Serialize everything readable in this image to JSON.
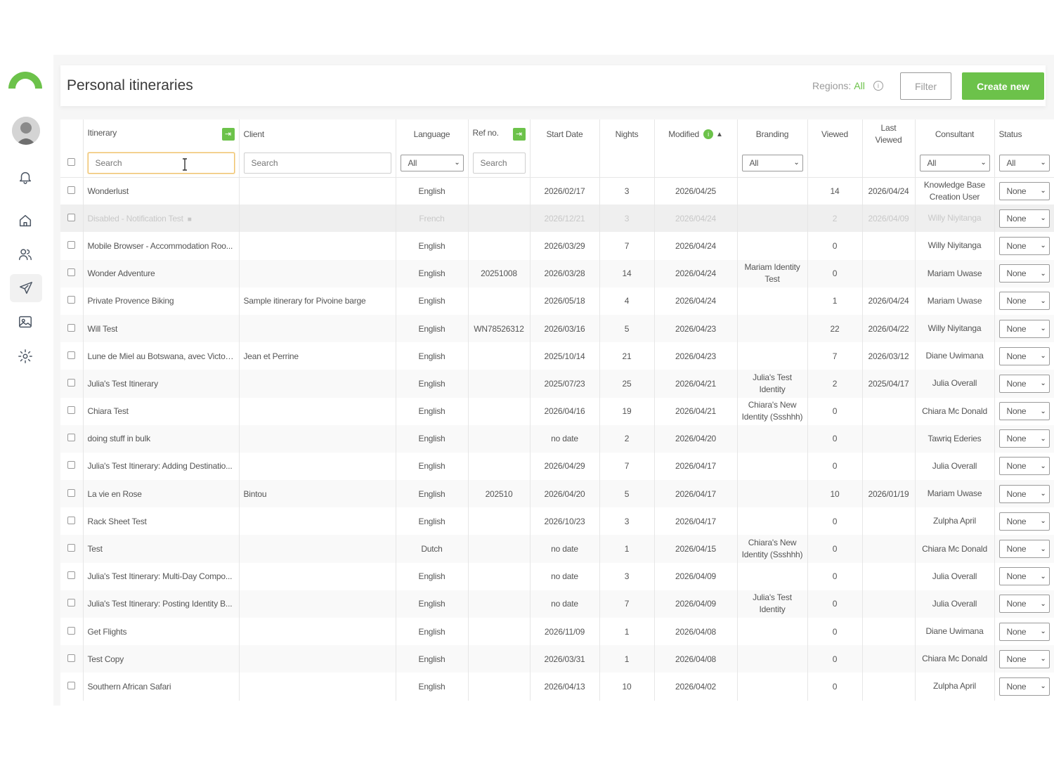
{
  "header": {
    "title": "Personal itineraries",
    "regions_label": "Regions:",
    "regions_value": "All",
    "filter_label": "Filter",
    "create_label": "Create new"
  },
  "sidebar": {
    "items": [
      {
        "name": "bell-icon"
      },
      {
        "name": "home-icon"
      },
      {
        "name": "users-icon"
      },
      {
        "name": "send-icon"
      },
      {
        "name": "image-icon"
      },
      {
        "name": "gear-icon"
      }
    ]
  },
  "table": {
    "columns": {
      "itinerary": "Itinerary",
      "client": "Client",
      "language": "Language",
      "ref": "Ref no.",
      "start": "Start Date",
      "nights": "Nights",
      "modified": "Modified",
      "branding": "Branding",
      "viewed": "Viewed",
      "last_viewed_1": "Last",
      "last_viewed_2": "Viewed",
      "consultant": "Consultant",
      "status": "Status"
    },
    "filters": {
      "itinerary_placeholder": "Search",
      "client_placeholder": "Search",
      "language_value": "All",
      "ref_placeholder": "Search",
      "branding_value": "All",
      "consultant_value": "All",
      "status_value": "All"
    },
    "rows": [
      {
        "itinerary": "Wonderlust",
        "client": "",
        "language": "English",
        "ref": "",
        "start": "2026/02/17",
        "nights": "3",
        "modified": "2026/04/25",
        "branding": "",
        "viewed": "14",
        "last_viewed": "2026/04/24",
        "consultant": "Knowledge Base Creation User",
        "status": "None"
      },
      {
        "itinerary": "Disabled - Notification Test",
        "client": "",
        "language": "French",
        "ref": "",
        "start": "2026/12/21",
        "nights": "3",
        "modified": "2026/04/24",
        "branding": "",
        "viewed": "2",
        "last_viewed": "2026/04/09",
        "consultant": "Willy Niyitanga",
        "status": "None",
        "disabled": true
      },
      {
        "itinerary": "Mobile Browser - Accommodation Roo...",
        "client": "",
        "language": "English",
        "ref": "",
        "start": "2026/03/29",
        "nights": "7",
        "modified": "2026/04/24",
        "branding": "",
        "viewed": "0",
        "last_viewed": "",
        "consultant": "Willy Niyitanga",
        "status": "None"
      },
      {
        "itinerary": "Wonder Adventure",
        "client": "",
        "language": "English",
        "ref": "20251008",
        "start": "2026/03/28",
        "nights": "14",
        "modified": "2026/04/24",
        "branding": "Mariam Identity Test",
        "viewed": "0",
        "last_viewed": "",
        "consultant": "Mariam Uwase",
        "status": "None"
      },
      {
        "itinerary": "Private Provence Biking",
        "client": "Sample itinerary for Pivoine barge",
        "language": "English",
        "ref": "",
        "start": "2026/05/18",
        "nights": "4",
        "modified": "2026/04/24",
        "branding": "",
        "viewed": "1",
        "last_viewed": "2026/04/24",
        "consultant": "Mariam Uwase",
        "status": "None"
      },
      {
        "itinerary": "Will Test",
        "client": "",
        "language": "English",
        "ref": "WN78526312",
        "start": "2026/03/16",
        "nights": "5",
        "modified": "2026/04/23",
        "branding": "",
        "viewed": "22",
        "last_viewed": "2026/04/22",
        "consultant": "Willy Niyitanga",
        "status": "None"
      },
      {
        "itinerary": "Lune de Miel au Botswana, avec Victori...",
        "client": "Jean et Perrine",
        "language": "English",
        "ref": "",
        "start": "2025/10/14",
        "nights": "21",
        "modified": "2026/04/23",
        "branding": "",
        "viewed": "7",
        "last_viewed": "2026/03/12",
        "consultant": "Diane Uwimana",
        "status": "None"
      },
      {
        "itinerary": "Julia's Test Itinerary",
        "client": "",
        "language": "English",
        "ref": "",
        "start": "2025/07/23",
        "nights": "25",
        "modified": "2026/04/21",
        "branding": "Julia's Test Identity",
        "viewed": "2",
        "last_viewed": "2025/04/17",
        "consultant": "Julia Overall",
        "status": "None"
      },
      {
        "itinerary": "Chiara Test",
        "client": "",
        "language": "English",
        "ref": "",
        "start": "2026/04/16",
        "nights": "19",
        "modified": "2026/04/21",
        "branding": "Chiara's New Identity (Ssshhh)",
        "viewed": "0",
        "last_viewed": "",
        "consultant": "Chiara Mc Donald",
        "status": "None"
      },
      {
        "itinerary": "doing stuff in bulk",
        "client": "",
        "language": "English",
        "ref": "",
        "start": "no date",
        "nights": "2",
        "modified": "2026/04/20",
        "branding": "",
        "viewed": "0",
        "last_viewed": "",
        "consultant": "Tawriq Ederies",
        "status": "None"
      },
      {
        "itinerary": "Julia's Test Itinerary: Adding Destinatio...",
        "client": "",
        "language": "English",
        "ref": "",
        "start": "2026/04/29",
        "nights": "7",
        "modified": "2026/04/17",
        "branding": "",
        "viewed": "0",
        "last_viewed": "",
        "consultant": "Julia Overall",
        "status": "None"
      },
      {
        "itinerary": "La vie en Rose",
        "client": "Bintou",
        "language": "English",
        "ref": "202510",
        "start": "2026/04/20",
        "nights": "5",
        "modified": "2026/04/17",
        "branding": "",
        "viewed": "10",
        "last_viewed": "2026/01/19",
        "consultant": "Mariam Uwase",
        "status": "None"
      },
      {
        "itinerary": "Rack Sheet Test",
        "client": "",
        "language": "English",
        "ref": "",
        "start": "2026/10/23",
        "nights": "3",
        "modified": "2026/04/17",
        "branding": "",
        "viewed": "0",
        "last_viewed": "",
        "consultant": "Zulpha April",
        "status": "None"
      },
      {
        "itinerary": "Test",
        "client": "",
        "language": "Dutch",
        "ref": "",
        "start": "no date",
        "nights": "1",
        "modified": "2026/04/15",
        "branding": "Chiara's New Identity (Ssshhh)",
        "viewed": "0",
        "last_viewed": "",
        "consultant": "Chiara Mc Donald",
        "status": "None"
      },
      {
        "itinerary": "Julia's Test Itinerary: Multi-Day Compo...",
        "client": "",
        "language": "English",
        "ref": "",
        "start": "no date",
        "nights": "3",
        "modified": "2026/04/09",
        "branding": "",
        "viewed": "0",
        "last_viewed": "",
        "consultant": "Julia Overall",
        "status": "None"
      },
      {
        "itinerary": "Julia's Test Itinerary: Posting Identity B...",
        "client": "",
        "language": "English",
        "ref": "",
        "start": "no date",
        "nights": "7",
        "modified": "2026/04/09",
        "branding": "Julia's Test Identity",
        "viewed": "0",
        "last_viewed": "",
        "consultant": "Julia Overall",
        "status": "None"
      },
      {
        "itinerary": "Get Flights",
        "client": "",
        "language": "English",
        "ref": "",
        "start": "2026/11/09",
        "nights": "1",
        "modified": "2026/04/08",
        "branding": "",
        "viewed": "0",
        "last_viewed": "",
        "consultant": "Diane Uwimana",
        "status": "None"
      },
      {
        "itinerary": "Test Copy",
        "client": "",
        "language": "English",
        "ref": "",
        "start": "2026/03/31",
        "nights": "1",
        "modified": "2026/04/08",
        "branding": "",
        "viewed": "0",
        "last_viewed": "",
        "consultant": "Chiara Mc Donald",
        "status": "None"
      },
      {
        "itinerary": "Southern African Safari",
        "client": "",
        "language": "English",
        "ref": "",
        "start": "2026/04/13",
        "nights": "10",
        "modified": "2026/04/02",
        "branding": "",
        "viewed": "0",
        "last_viewed": "",
        "consultant": "Zulpha April",
        "status": "None"
      }
    ]
  },
  "colors": {
    "accent": "#6cc24a",
    "text": "#555555",
    "muted": "#9a9a9a"
  }
}
